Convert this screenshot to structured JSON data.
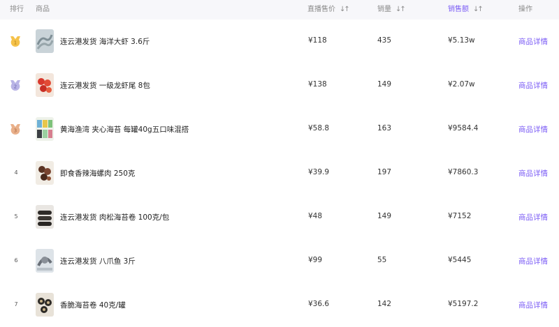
{
  "header": {
    "rank": "排行",
    "product": "商品",
    "price": "直播售价",
    "qty": "销量",
    "sales": "销售额",
    "action": "操作"
  },
  "colors": {
    "accent": "#7b5cf5",
    "header_bg": "#f7f7fa",
    "gold": "#f5c24a",
    "silver": "#b9b4e6",
    "bronze": "#e9b08a"
  },
  "rows": [
    {
      "rank": "",
      "medal": "gold-medal-icon",
      "name": "连云港发货 海洋大虾 3.6斤",
      "price": "¥118",
      "qty": "435",
      "sales": "¥5.13w",
      "detail": "商品详情"
    },
    {
      "rank": "",
      "medal": "silver-medal-icon",
      "name": "连云港发货 一级龙虾尾 8包",
      "price": "¥138",
      "qty": "149",
      "sales": "¥2.07w",
      "detail": "商品详情"
    },
    {
      "rank": "",
      "medal": "bronze-medal-icon",
      "name": "黄海渔湾 夹心海苔 每罐40g五口味混搭",
      "price": "¥58.8",
      "qty": "163",
      "sales": "¥9584.4",
      "detail": "商品详情"
    },
    {
      "rank": "4",
      "medal": "",
      "name": "即食香辣海螺肉 250克",
      "price": "¥39.9",
      "qty": "197",
      "sales": "¥7860.3",
      "detail": "商品详情"
    },
    {
      "rank": "5",
      "medal": "",
      "name": "连云港发货 肉松海苔卷 100克/包",
      "price": "¥48",
      "qty": "149",
      "sales": "¥7152",
      "detail": "商品详情"
    },
    {
      "rank": "6",
      "medal": "",
      "name": "连云港发货 八爪鱼 3斤",
      "price": "¥99",
      "qty": "55",
      "sales": "¥5445",
      "detail": "商品详情"
    },
    {
      "rank": "7",
      "medal": "",
      "name": "香脆海苔卷 40克/罐",
      "price": "¥36.6",
      "qty": "142",
      "sales": "¥5197.2",
      "detail": "商品详情"
    }
  ]
}
